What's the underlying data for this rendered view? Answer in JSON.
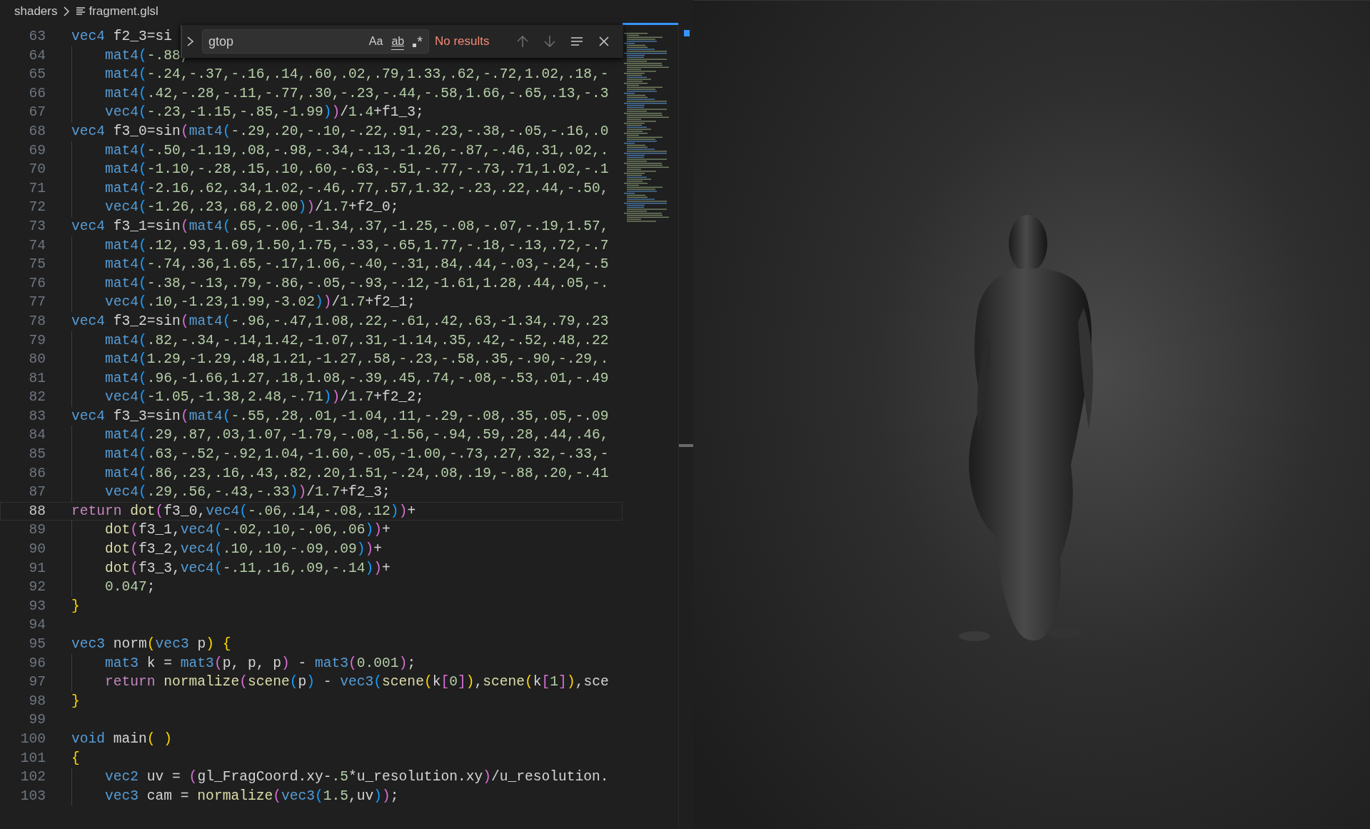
{
  "breadcrumb": [
    {
      "kind": "folder",
      "label": "shaders"
    },
    {
      "kind": "file",
      "label": "fragment.glsl"
    }
  ],
  "find_widget": {
    "value": "gtop",
    "options": [
      {
        "kind": "case",
        "label": "Aa",
        "on": false
      },
      {
        "kind": "word",
        "label": "ab",
        "on": false
      },
      {
        "kind": "regex",
        "label": "*",
        "on": false
      }
    ],
    "status": "No results"
  },
  "editor": {
    "lines": [
      {
        "number": "63",
        "current": false,
        "indented": false,
        "spans": [
          {
            "kind": "type",
            "text": "vec4"
          },
          {
            "kind": "plain",
            "text": " f2_3=si"
          }
        ]
      },
      {
        "number": "64",
        "current": false,
        "indented": true,
        "spans": [
          {
            "kind": "type",
            "text": "mat4"
          },
          {
            "kind": "b3",
            "text": "("
          },
          {
            "kind": "num",
            "text": "-.88,"
          }
        ]
      },
      {
        "number": "65",
        "current": false,
        "indented": true,
        "spans": [
          {
            "kind": "type",
            "text": "mat4"
          },
          {
            "kind": "b3",
            "text": "("
          },
          {
            "kind": "num",
            "text": "-.24,-.37,-.16,.14,.60,.02,.79,1.33,.62,-.72,1.02,.18,-"
          }
        ]
      },
      {
        "number": "66",
        "current": false,
        "indented": true,
        "spans": [
          {
            "kind": "type",
            "text": "mat4"
          },
          {
            "kind": "b3",
            "text": "("
          },
          {
            "kind": "num",
            "text": ".42,-.28,-.11,-.77,.30,-.23,-.44,-.58,1.66,-.65,.13,-.3"
          }
        ]
      },
      {
        "number": "67",
        "current": false,
        "indented": true,
        "spans": [
          {
            "kind": "type",
            "text": "vec4"
          },
          {
            "kind": "b3",
            "text": "("
          },
          {
            "kind": "num",
            "text": "-.23,-1.15,-.85,-1.99"
          },
          {
            "kind": "b3",
            "text": ")"
          },
          {
            "kind": "b2",
            "text": ")"
          },
          {
            "kind": "plain",
            "text": "/"
          },
          {
            "kind": "num",
            "text": "1.4"
          },
          {
            "kind": "plain",
            "text": "+f1_3;"
          }
        ]
      },
      {
        "number": "68",
        "current": false,
        "indented": false,
        "spans": [
          {
            "kind": "type",
            "text": "vec4"
          },
          {
            "kind": "plain",
            "text": " f3_0=sin"
          },
          {
            "kind": "b2",
            "text": "("
          },
          {
            "kind": "type",
            "text": "mat4"
          },
          {
            "kind": "b3",
            "text": "("
          },
          {
            "kind": "num",
            "text": "-.29,.20,-.10,-.22,.91,-.23,-.38,-.05,-.16,.0"
          }
        ]
      },
      {
        "number": "69",
        "current": false,
        "indented": true,
        "spans": [
          {
            "kind": "type",
            "text": "mat4"
          },
          {
            "kind": "b3",
            "text": "("
          },
          {
            "kind": "num",
            "text": "-.50,-1.19,.08,-.98,-.34,-.13,-1.26,-.87,-.46,.31,.02,."
          }
        ]
      },
      {
        "number": "70",
        "current": false,
        "indented": true,
        "spans": [
          {
            "kind": "type",
            "text": "mat4"
          },
          {
            "kind": "b3",
            "text": "("
          },
          {
            "kind": "num",
            "text": "-1.10,-.28,.15,.10,.60,-.63,-.51,-.77,-.73,.71,1.02,-.1"
          }
        ]
      },
      {
        "number": "71",
        "current": false,
        "indented": true,
        "spans": [
          {
            "kind": "type",
            "text": "mat4"
          },
          {
            "kind": "b3",
            "text": "("
          },
          {
            "kind": "num",
            "text": "-2.16,.62,.34,1.02,-.46,.77,.57,1.32,-.23,.22,.44,-.50,"
          }
        ]
      },
      {
        "number": "72",
        "current": false,
        "indented": true,
        "spans": [
          {
            "kind": "type",
            "text": "vec4"
          },
          {
            "kind": "b3",
            "text": "("
          },
          {
            "kind": "num",
            "text": "-1.26,.23,.68,2.00"
          },
          {
            "kind": "b3",
            "text": ")"
          },
          {
            "kind": "b2",
            "text": ")"
          },
          {
            "kind": "plain",
            "text": "/"
          },
          {
            "kind": "num",
            "text": "1.7"
          },
          {
            "kind": "plain",
            "text": "+f2_0;"
          }
        ]
      },
      {
        "number": "73",
        "current": false,
        "indented": false,
        "spans": [
          {
            "kind": "type",
            "text": "vec4"
          },
          {
            "kind": "plain",
            "text": " f3_1=sin"
          },
          {
            "kind": "b2",
            "text": "("
          },
          {
            "kind": "type",
            "text": "mat4"
          },
          {
            "kind": "b3",
            "text": "("
          },
          {
            "kind": "num",
            "text": ".65,-.06,-1.34,.37,-1.25,-.08,-.07,-.19,1.57,"
          }
        ]
      },
      {
        "number": "74",
        "current": false,
        "indented": true,
        "spans": [
          {
            "kind": "type",
            "text": "mat4"
          },
          {
            "kind": "b3",
            "text": "("
          },
          {
            "kind": "num",
            "text": ".12,.93,1.69,1.50,1.75,-.33,-.65,1.77,-.18,-.13,.72,-.7"
          }
        ]
      },
      {
        "number": "75",
        "current": false,
        "indented": true,
        "spans": [
          {
            "kind": "type",
            "text": "mat4"
          },
          {
            "kind": "b3",
            "text": "("
          },
          {
            "kind": "num",
            "text": "-.74,.36,1.65,-.17,1.06,-.40,-.31,.84,.44,-.03,-.24,-.5"
          }
        ]
      },
      {
        "number": "76",
        "current": false,
        "indented": true,
        "spans": [
          {
            "kind": "type",
            "text": "mat4"
          },
          {
            "kind": "b3",
            "text": "("
          },
          {
            "kind": "num",
            "text": "-.38,-.13,.79,-.86,-.05,-.93,-.12,-1.61,1.28,.44,.05,-."
          }
        ]
      },
      {
        "number": "77",
        "current": false,
        "indented": true,
        "spans": [
          {
            "kind": "type",
            "text": "vec4"
          },
          {
            "kind": "b3",
            "text": "("
          },
          {
            "kind": "num",
            "text": ".10,-1.23,1.99,-3.02"
          },
          {
            "kind": "b3",
            "text": ")"
          },
          {
            "kind": "b2",
            "text": ")"
          },
          {
            "kind": "plain",
            "text": "/"
          },
          {
            "kind": "num",
            "text": "1.7"
          },
          {
            "kind": "plain",
            "text": "+f2_1;"
          }
        ]
      },
      {
        "number": "78",
        "current": false,
        "indented": false,
        "spans": [
          {
            "kind": "type",
            "text": "vec4"
          },
          {
            "kind": "plain",
            "text": " f3_2=sin"
          },
          {
            "kind": "b2",
            "text": "("
          },
          {
            "kind": "type",
            "text": "mat4"
          },
          {
            "kind": "b3",
            "text": "("
          },
          {
            "kind": "num",
            "text": "-.96,-.47,1.08,.22,-.61,.42,.63,-1.34,.79,.23"
          }
        ]
      },
      {
        "number": "79",
        "current": false,
        "indented": true,
        "spans": [
          {
            "kind": "type",
            "text": "mat4"
          },
          {
            "kind": "b3",
            "text": "("
          },
          {
            "kind": "num",
            "text": ".82,-.34,-.14,1.42,-1.07,.31,-1.14,.35,.42,-.52,.48,.22"
          }
        ]
      },
      {
        "number": "80",
        "current": false,
        "indented": true,
        "spans": [
          {
            "kind": "type",
            "text": "mat4"
          },
          {
            "kind": "b3",
            "text": "("
          },
          {
            "kind": "num",
            "text": "1.29,-1.29,.48,1.21,-1.27,.58,-.23,-.58,.35,-.90,-.29,."
          }
        ]
      },
      {
        "number": "81",
        "current": false,
        "indented": true,
        "spans": [
          {
            "kind": "type",
            "text": "mat4"
          },
          {
            "kind": "b3",
            "text": "("
          },
          {
            "kind": "num",
            "text": ".96,-1.66,1.27,.18,1.08,-.39,.45,.74,-.08,-.53,.01,-.49"
          }
        ]
      },
      {
        "number": "82",
        "current": false,
        "indented": true,
        "spans": [
          {
            "kind": "type",
            "text": "vec4"
          },
          {
            "kind": "b3",
            "text": "("
          },
          {
            "kind": "num",
            "text": "-1.05,-1.38,2.48,-.71"
          },
          {
            "kind": "b3",
            "text": ")"
          },
          {
            "kind": "b2",
            "text": ")"
          },
          {
            "kind": "plain",
            "text": "/"
          },
          {
            "kind": "num",
            "text": "1.7"
          },
          {
            "kind": "plain",
            "text": "+f2_2;"
          }
        ]
      },
      {
        "number": "83",
        "current": false,
        "indented": false,
        "spans": [
          {
            "kind": "type",
            "text": "vec4"
          },
          {
            "kind": "plain",
            "text": " f3_3=sin"
          },
          {
            "kind": "b2",
            "text": "("
          },
          {
            "kind": "type",
            "text": "mat4"
          },
          {
            "kind": "b3",
            "text": "("
          },
          {
            "kind": "num",
            "text": "-.55,.28,.01,-1.04,.11,-.29,-.08,.35,.05,-.09"
          }
        ]
      },
      {
        "number": "84",
        "current": false,
        "indented": true,
        "spans": [
          {
            "kind": "type",
            "text": "mat4"
          },
          {
            "kind": "b3",
            "text": "("
          },
          {
            "kind": "num",
            "text": ".29,.87,.03,1.07,-1.79,-.08,-1.56,-.94,.59,.28,.44,.46,"
          }
        ]
      },
      {
        "number": "85",
        "current": false,
        "indented": true,
        "spans": [
          {
            "kind": "type",
            "text": "mat4"
          },
          {
            "kind": "b3",
            "text": "("
          },
          {
            "kind": "num",
            "text": ".63,-.52,-.92,1.04,-1.60,-.05,-1.00,-.73,.27,.32,-.33,-"
          }
        ]
      },
      {
        "number": "86",
        "current": false,
        "indented": true,
        "spans": [
          {
            "kind": "type",
            "text": "mat4"
          },
          {
            "kind": "b3",
            "text": "("
          },
          {
            "kind": "num",
            "text": ".86,.23,.16,.43,.82,.20,1.51,-.24,.08,.19,-.88,.20,-.41"
          }
        ]
      },
      {
        "number": "87",
        "current": false,
        "indented": true,
        "spans": [
          {
            "kind": "type",
            "text": "vec4"
          },
          {
            "kind": "b3",
            "text": "("
          },
          {
            "kind": "num",
            "text": ".29,.56,-.43,-.33"
          },
          {
            "kind": "b3",
            "text": ")"
          },
          {
            "kind": "b2",
            "text": ")"
          },
          {
            "kind": "plain",
            "text": "/"
          },
          {
            "kind": "num",
            "text": "1.7"
          },
          {
            "kind": "plain",
            "text": "+f2_3;"
          }
        ]
      },
      {
        "number": "88",
        "current": true,
        "indented": false,
        "spans": [
          {
            "kind": "kw",
            "text": "return "
          },
          {
            "kind": "fn",
            "text": "dot"
          },
          {
            "kind": "b2",
            "text": "("
          },
          {
            "kind": "plain",
            "text": "f3_0,"
          },
          {
            "kind": "type",
            "text": "vec4"
          },
          {
            "kind": "b3",
            "text": "("
          },
          {
            "kind": "num",
            "text": "-.06,.14,-.08,.12"
          },
          {
            "kind": "b3",
            "text": ")"
          },
          {
            "kind": "b2",
            "text": ")"
          },
          {
            "kind": "plain",
            "text": "+"
          }
        ]
      },
      {
        "number": "89",
        "current": false,
        "indented": true,
        "spans": [
          {
            "kind": "fn",
            "text": "dot"
          },
          {
            "kind": "b2",
            "text": "("
          },
          {
            "kind": "plain",
            "text": "f3_1,"
          },
          {
            "kind": "type",
            "text": "vec4"
          },
          {
            "kind": "b3",
            "text": "("
          },
          {
            "kind": "num",
            "text": "-.02,.10,-.06,.06"
          },
          {
            "kind": "b3",
            "text": ")"
          },
          {
            "kind": "b2",
            "text": ")"
          },
          {
            "kind": "plain",
            "text": "+"
          }
        ]
      },
      {
        "number": "90",
        "current": false,
        "indented": true,
        "spans": [
          {
            "kind": "fn",
            "text": "dot"
          },
          {
            "kind": "b2",
            "text": "("
          },
          {
            "kind": "plain",
            "text": "f3_2,"
          },
          {
            "kind": "type",
            "text": "vec4"
          },
          {
            "kind": "b3",
            "text": "("
          },
          {
            "kind": "num",
            "text": ".10,.10,-.09,.09"
          },
          {
            "kind": "b3",
            "text": ")"
          },
          {
            "kind": "b2",
            "text": ")"
          },
          {
            "kind": "plain",
            "text": "+"
          }
        ]
      },
      {
        "number": "91",
        "current": false,
        "indented": true,
        "spans": [
          {
            "kind": "fn",
            "text": "dot"
          },
          {
            "kind": "b2",
            "text": "("
          },
          {
            "kind": "plain",
            "text": "f3_3,"
          },
          {
            "kind": "type",
            "text": "vec4"
          },
          {
            "kind": "b3",
            "text": "("
          },
          {
            "kind": "num",
            "text": "-.11,.16,.09,-.14"
          },
          {
            "kind": "b3",
            "text": ")"
          },
          {
            "kind": "b2",
            "text": ")"
          },
          {
            "kind": "plain",
            "text": "+"
          }
        ]
      },
      {
        "number": "92",
        "current": false,
        "indented": true,
        "spans": [
          {
            "kind": "num",
            "text": "0.047"
          },
          {
            "kind": "plain",
            "text": ";"
          }
        ]
      },
      {
        "number": "93",
        "current": false,
        "indented": false,
        "spans": [
          {
            "kind": "b1",
            "text": "}"
          }
        ]
      },
      {
        "number": "94",
        "current": false,
        "indented": false
      },
      {
        "number": "95",
        "current": false,
        "indented": false,
        "spans": [
          {
            "kind": "type",
            "text": "vec3"
          },
          {
            "kind": "plain",
            "text": " norm"
          },
          {
            "kind": "b1",
            "text": "("
          },
          {
            "kind": "type",
            "text": "vec3"
          },
          {
            "kind": "plain",
            "text": " p"
          },
          {
            "kind": "b1",
            "text": ") {"
          }
        ]
      },
      {
        "number": "96",
        "current": false,
        "indented": true,
        "spans": [
          {
            "kind": "type",
            "text": "mat3"
          },
          {
            "kind": "plain",
            "text": " k = "
          },
          {
            "kind": "type",
            "text": "mat3"
          },
          {
            "kind": "b2",
            "text": "("
          },
          {
            "kind": "plain",
            "text": "p, p, p"
          },
          {
            "kind": "b2",
            "text": ")"
          },
          {
            "kind": "plain",
            "text": " - "
          },
          {
            "kind": "type",
            "text": "mat3"
          },
          {
            "kind": "b2",
            "text": "("
          },
          {
            "kind": "num",
            "text": "0.001"
          },
          {
            "kind": "b2",
            "text": ")"
          },
          {
            "kind": "plain",
            "text": ";"
          }
        ]
      },
      {
        "number": "97",
        "current": false,
        "indented": true,
        "spans": [
          {
            "kind": "kw",
            "text": "return "
          },
          {
            "kind": "fn",
            "text": "normalize"
          },
          {
            "kind": "b2",
            "text": "("
          },
          {
            "kind": "fn",
            "text": "scene"
          },
          {
            "kind": "b3",
            "text": "("
          },
          {
            "kind": "plain",
            "text": "p"
          },
          {
            "kind": "b3",
            "text": ")"
          },
          {
            "kind": "plain",
            "text": " - "
          },
          {
            "kind": "type",
            "text": "vec3"
          },
          {
            "kind": "b3",
            "text": "("
          },
          {
            "kind": "fn",
            "text": "scene"
          },
          {
            "kind": "b1",
            "text": "("
          },
          {
            "kind": "plain",
            "text": "k"
          },
          {
            "kind": "b2",
            "text": "["
          },
          {
            "kind": "num",
            "text": "0"
          },
          {
            "kind": "b2",
            "text": "]"
          },
          {
            "kind": "b1",
            "text": ")"
          },
          {
            "kind": "plain",
            "text": ","
          },
          {
            "kind": "fn",
            "text": "scene"
          },
          {
            "kind": "b1",
            "text": "("
          },
          {
            "kind": "plain",
            "text": "k"
          },
          {
            "kind": "b2",
            "text": "["
          },
          {
            "kind": "num",
            "text": "1"
          },
          {
            "kind": "b2",
            "text": "]"
          },
          {
            "kind": "b1",
            "text": ")"
          },
          {
            "kind": "plain",
            "text": ",sce"
          }
        ]
      },
      {
        "number": "98",
        "current": false,
        "indented": false,
        "spans": [
          {
            "kind": "b1",
            "text": "}"
          }
        ]
      },
      {
        "number": "99",
        "current": false,
        "indented": false
      },
      {
        "number": "100",
        "current": false,
        "indented": false,
        "spans": [
          {
            "kind": "type",
            "text": "void"
          },
          {
            "kind": "plain",
            "text": " main"
          },
          {
            "kind": "b1",
            "text": "( )"
          }
        ]
      },
      {
        "number": "101",
        "current": false,
        "indented": false,
        "spans": [
          {
            "kind": "b1",
            "text": "{"
          }
        ]
      },
      {
        "number": "102",
        "current": false,
        "indented": true,
        "spans": [
          {
            "kind": "type",
            "text": "vec2"
          },
          {
            "kind": "plain",
            "text": " uv = "
          },
          {
            "kind": "b2",
            "text": "("
          },
          {
            "kind": "plain",
            "text": "gl_FragCoord.xy-"
          },
          {
            "kind": "num",
            "text": ".5"
          },
          {
            "kind": "plain",
            "text": "*u_resolution.xy"
          },
          {
            "kind": "b2",
            "text": ")"
          },
          {
            "kind": "plain",
            "text": "/u_resolution."
          }
        ]
      },
      {
        "number": "103",
        "current": false,
        "indented": true,
        "spans": [
          {
            "kind": "type",
            "text": "vec3"
          },
          {
            "kind": "plain",
            "text": " cam = "
          },
          {
            "kind": "fn",
            "text": "normalize"
          },
          {
            "kind": "b2",
            "text": "("
          },
          {
            "kind": "type",
            "text": "vec3"
          },
          {
            "kind": "b3",
            "text": "("
          },
          {
            "kind": "num",
            "text": "1.5"
          },
          {
            "kind": "plain",
            "text": ",uv"
          },
          {
            "kind": "b3",
            "text": ")"
          },
          {
            "kind": "b2",
            "text": ")"
          },
          {
            "kind": "plain",
            "text": ";"
          }
        ]
      }
    ]
  }
}
